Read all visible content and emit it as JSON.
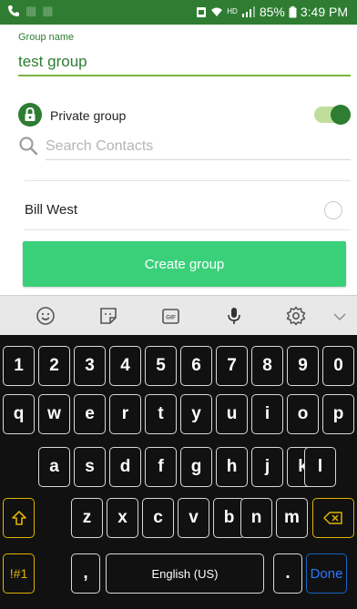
{
  "status_bar": {
    "battery_text": "85%",
    "time": "3:49 PM",
    "network_label": "HD"
  },
  "form": {
    "group_name_label": "Group name",
    "group_name_value": "test group",
    "private_group_label": "Private group",
    "private_group_enabled": true,
    "search_placeholder": "Search Contacts"
  },
  "contacts": [
    {
      "name": "Bill West",
      "selected": false
    }
  ],
  "create_button_label": "Create group",
  "keyboard": {
    "toolbar": [
      "emoji-icon",
      "sticker-icon",
      "gif-icon",
      "microphone-icon",
      "settings-icon",
      "chevron-down-icon"
    ],
    "gif_label": "GIF",
    "row1": [
      "1",
      "2",
      "3",
      "4",
      "5",
      "6",
      "7",
      "8",
      "9",
      "0"
    ],
    "row2": [
      "q",
      "w",
      "e",
      "r",
      "t",
      "y",
      "u",
      "i",
      "o",
      "p"
    ],
    "row3": [
      "a",
      "s",
      "d",
      "f",
      "g",
      "h",
      "j",
      "k",
      "l"
    ],
    "row4": [
      "z",
      "x",
      "c",
      "v",
      "b",
      "n",
      "m"
    ],
    "symbols_label": "!#1",
    "comma_label": ",",
    "space_label": "English (US)",
    "period_label": ".",
    "done_label": "Done"
  },
  "colors": {
    "status_bar": "#2e7d32",
    "accent": "#2e7d32",
    "button": "#3ad07a",
    "keyboard_bg": "#111111",
    "gold_keys": "#e0b300",
    "done_key": "#2979ff"
  }
}
